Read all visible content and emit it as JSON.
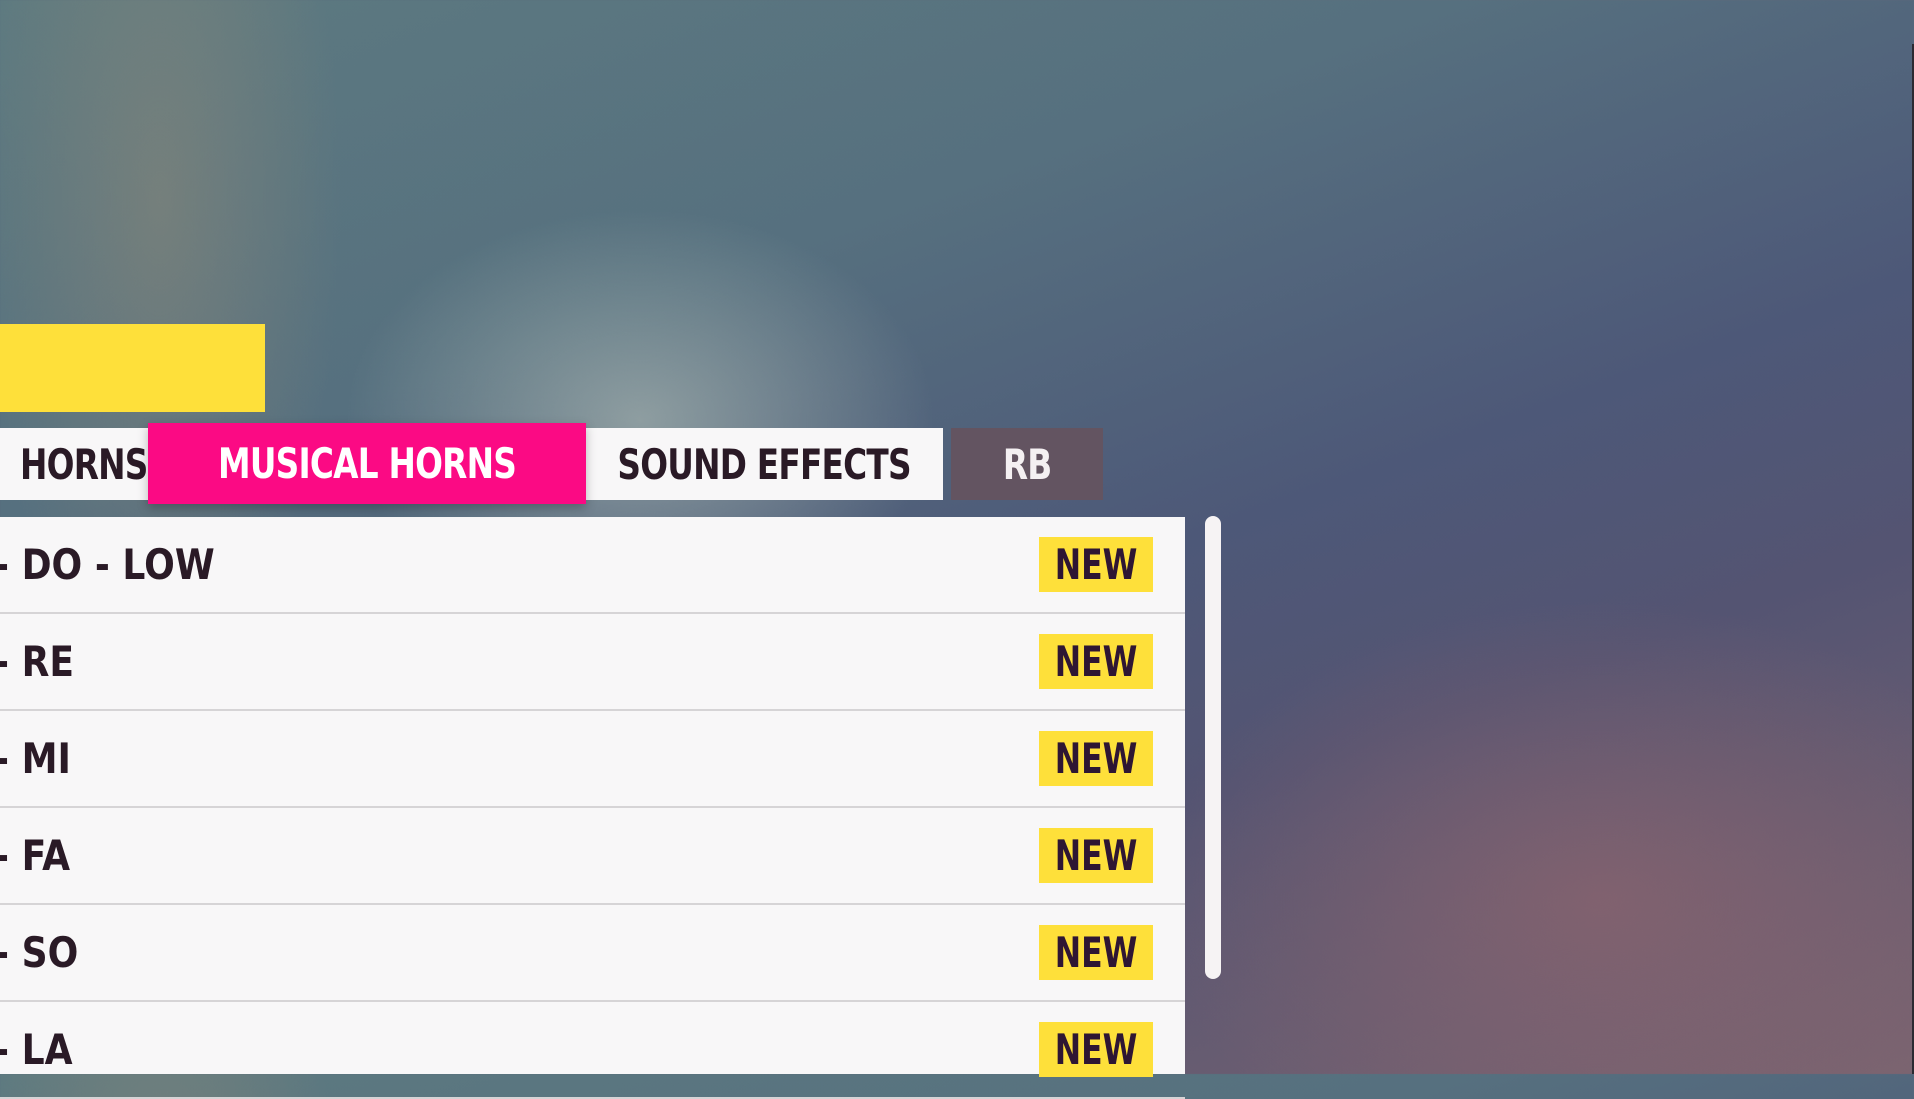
{
  "header": {
    "title_block": ""
  },
  "tabs": [
    {
      "label": "HORNS",
      "state": "inactive"
    },
    {
      "label": "MUSICAL HORNS",
      "state": "active"
    },
    {
      "label": "SOUND EFFECTS",
      "state": "inactive"
    },
    {
      "label": "RB",
      "state": "controller-hint"
    }
  ],
  "list": {
    "items": [
      {
        "label": "- DO - LOW",
        "badge": "NEW"
      },
      {
        "label": "- RE",
        "badge": "NEW"
      },
      {
        "label": "- MI",
        "badge": "NEW"
      },
      {
        "label": "- FA",
        "badge": "NEW"
      },
      {
        "label": "- SO",
        "badge": "NEW"
      },
      {
        "label": "- LA",
        "badge": "NEW"
      }
    ]
  },
  "colors": {
    "accent_pink": "#fb0a84",
    "accent_yellow": "#fee03a",
    "text_dark": "#2a1a26",
    "button_hint_bg": "#635461"
  }
}
